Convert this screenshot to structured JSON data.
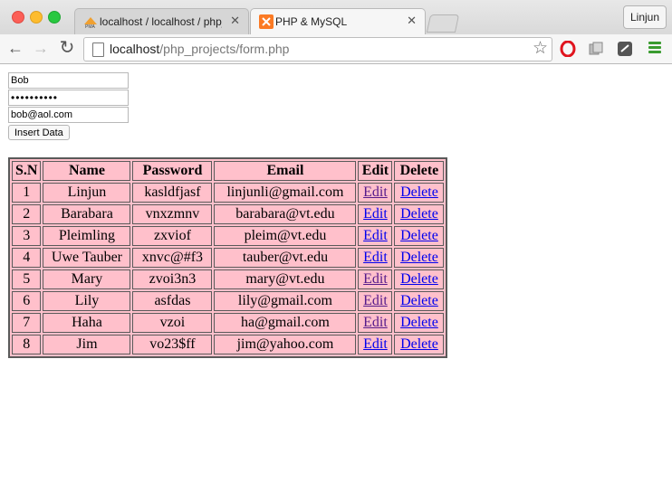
{
  "browser": {
    "tabs": [
      {
        "label": "localhost / localhost / php_projects",
        "active": false,
        "icon": "phpmyadmin-icon"
      },
      {
        "label": "PHP & MySQL",
        "active": true,
        "icon": "xampp-icon"
      }
    ],
    "profile_label": "Linjun",
    "url_host": "localhost",
    "url_path": "/php_projects/form.php",
    "close_glyph": "✕"
  },
  "form": {
    "name_value": "Bob",
    "password_value": "••••••••••",
    "email_value": "bob@aol.com",
    "submit_label": "Insert Data"
  },
  "table": {
    "headers": [
      "S.N",
      "Name",
      "Password",
      "Email",
      "Edit",
      "Delete"
    ],
    "rows": [
      {
        "sn": "1",
        "name": "Linjun",
        "password": "kasldfjasf",
        "email": "linjunli@gmail.com",
        "edit": "Edit",
        "delete": "Delete"
      },
      {
        "sn": "2",
        "name": "Barabara",
        "password": "vnxzmnv",
        "email": "barabara@vt.edu",
        "edit": "Edit",
        "delete": "Delete"
      },
      {
        "sn": "3",
        "name": "Pleimling",
        "password": "zxviof",
        "email": "pleim@vt.edu",
        "edit": "Edit",
        "delete": "Delete"
      },
      {
        "sn": "4",
        "name": "Uwe Tauber",
        "password": "xnvc@#f3",
        "email": "tauber@vt.edu",
        "edit": "Edit",
        "delete": "Delete"
      },
      {
        "sn": "5",
        "name": "Mary",
        "password": "zvoi3n3",
        "email": "mary@vt.edu",
        "edit": "Edit",
        "delete": "Delete"
      },
      {
        "sn": "6",
        "name": "Lily",
        "password": "asfdas",
        "email": "lily@gmail.com",
        "edit": "Edit",
        "delete": "Delete"
      },
      {
        "sn": "7",
        "name": "Haha",
        "password": "vzoi",
        "email": "ha@gmail.com",
        "edit": "Edit",
        "delete": "Delete"
      },
      {
        "sn": "8",
        "name": "Jim",
        "password": "vo23$ff",
        "email": "jim@yahoo.com",
        "edit": "Edit",
        "delete": "Delete"
      }
    ],
    "visited_edit_rows": [
      1,
      5,
      6,
      7
    ],
    "background": "#ffc0cb",
    "link_color": "#0000ee",
    "visited_color": "#551a8b"
  }
}
